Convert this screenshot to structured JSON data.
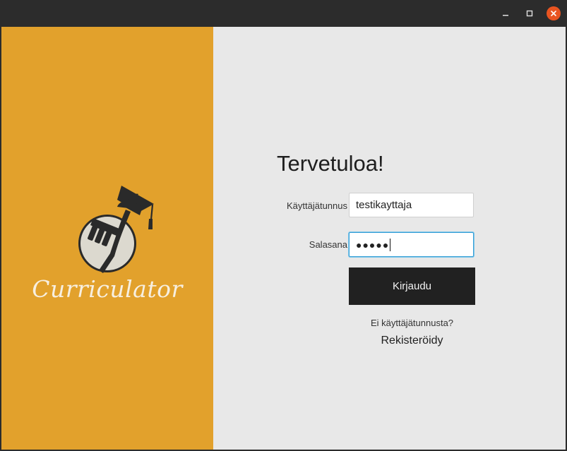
{
  "window": {
    "controls": {
      "minimize_icon": "minimize-icon",
      "maximize_icon": "maximize-icon",
      "close_icon": "close-icon"
    },
    "close_color": "#e95420"
  },
  "brand": {
    "name": "Curriculator",
    "panel_color": "#e2a12c",
    "logo_icon": "graduate-brush-icon"
  },
  "login": {
    "welcome": "Tervetuloa!",
    "username_label": "Käyttäjätunnus",
    "username_value": "testikayttaja",
    "password_label": "Salasana",
    "password_masked": "●●●●●",
    "submit_label": "Kirjaudu",
    "no_account_text": "Ei käyttäjätunnusta?",
    "register_label": "Rekisteröidy"
  }
}
